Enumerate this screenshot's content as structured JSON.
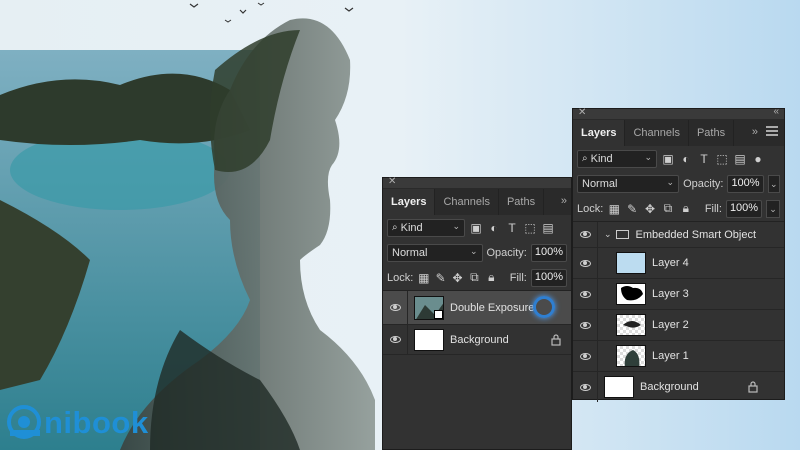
{
  "brand": {
    "logo_text": "nibook"
  },
  "panel_left": {
    "tabs": [
      {
        "label": "Layers",
        "active": true
      },
      {
        "label": "Channels",
        "active": false
      },
      {
        "label": "Paths",
        "active": false
      }
    ],
    "filter": {
      "kind_label": "Kind"
    },
    "blend_mode": "Normal",
    "opacity_label": "Opacity:",
    "opacity_value": "100%",
    "lock_label": "Lock:",
    "fill_label": "Fill:",
    "fill_value": "100%",
    "layers": [
      {
        "name": "Double Exposure",
        "selected": true,
        "smart_object": true
      },
      {
        "name": "Background",
        "locked": true
      }
    ]
  },
  "panel_right": {
    "tabs": [
      {
        "label": "Layers",
        "active": true
      },
      {
        "label": "Channels",
        "active": false
      },
      {
        "label": "Paths",
        "active": false
      }
    ],
    "filter": {
      "kind_label": "Kind"
    },
    "blend_mode": "Normal",
    "opacity_label": "Opacity:",
    "opacity_value": "100%",
    "lock_label": "Lock:",
    "fill_label": "Fill:",
    "fill_value": "100%",
    "group": {
      "name": "Embedded Smart Object",
      "expanded": true
    },
    "layers": [
      {
        "name": "Layer 4"
      },
      {
        "name": "Layer 3"
      },
      {
        "name": "Layer 2"
      },
      {
        "name": "Layer 1"
      },
      {
        "name": "Background",
        "locked": true
      }
    ]
  },
  "colors": {
    "panel_bg": "#323232",
    "accent_ring": "#2f7fd1",
    "logo_blue": "#1f8fd6",
    "sky": "#cfe4f3"
  }
}
